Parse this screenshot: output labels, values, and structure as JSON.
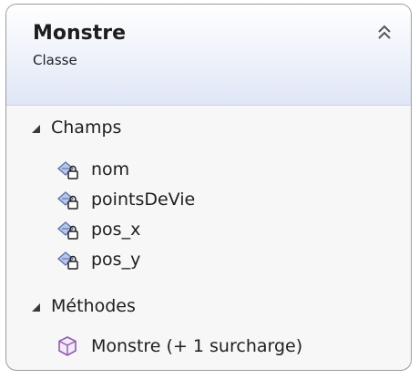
{
  "class_box": {
    "title": "Monstre",
    "subtitle": "Classe",
    "collapse_icon": "double-chevron-up-icon"
  },
  "sections": [
    {
      "label": "Champs",
      "expand_icon": "expanded-triangle-icon",
      "items": [
        {
          "label": "nom",
          "icon": "private-field-icon"
        },
        {
          "label": "pointsDeVie",
          "icon": "private-field-icon"
        },
        {
          "label": "pos_x",
          "icon": "private-field-icon"
        },
        {
          "label": "pos_y",
          "icon": "private-field-icon"
        }
      ]
    },
    {
      "label": "Méthodes",
      "expand_icon": "expanded-triangle-icon",
      "items": [
        {
          "label": "Monstre (+ 1 surcharge)",
          "icon": "method-cube-icon"
        }
      ]
    }
  ],
  "colors": {
    "header_gradient_end": "#dfe6f6",
    "border": "#9b9b9b",
    "field_icon": "#7c8fc4",
    "method_icon": "#9b69b8"
  }
}
